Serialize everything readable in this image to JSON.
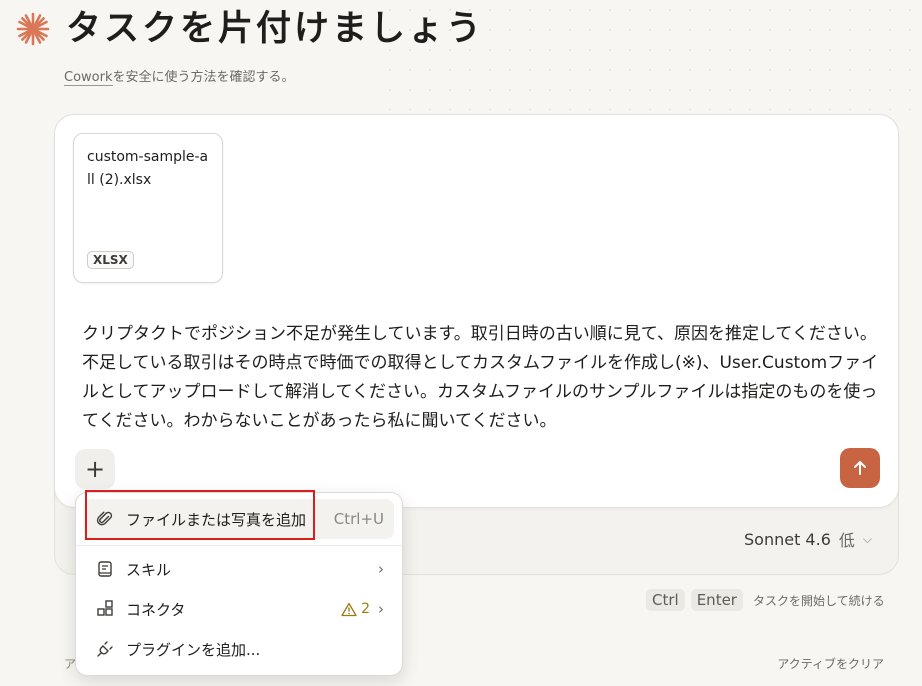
{
  "header": {
    "title": "タスクを片付けましょう",
    "subtitle_link": "Cowork",
    "subtitle_rest": "を安全に使う方法を確認する。",
    "logo_icon": "asterisk-burst-icon",
    "accent_color": "#d97757"
  },
  "composer": {
    "attachment": {
      "name": "custom-sample-all (2).xlsx",
      "type": "XLSX"
    },
    "prompt": "クリプタクトでポジション不足が発生しています。取引日時の古い順に見て、原因を推定してください。不足している取引はその時点で時価での取得としてカスタムファイルを作成し(※)、User.Customファイルとしてアップロードして解消してください。カスタムファイルのサンプルファイルは指定のものを使ってください。わからないことがあったら私に聞いてください。",
    "add_button": "+",
    "send_color": "#c96442"
  },
  "model": {
    "name": "Sonnet 4.6",
    "effort": "低",
    "chevron": "⌵"
  },
  "shortcut": {
    "key1": "Ctrl",
    "key2": "Enter",
    "text": "タスクを開始して続ける"
  },
  "footer": {
    "left": "ア",
    "right": "アクティブをクリア"
  },
  "menu": {
    "upload": {
      "label": "ファイルまたは写真を追加",
      "shortcut": "Ctrl+U"
    },
    "skill": {
      "label": "スキル"
    },
    "connector": {
      "label": "コネクタ",
      "warning_count": "2"
    },
    "plugin": {
      "label": "プラグインを追加..."
    }
  }
}
